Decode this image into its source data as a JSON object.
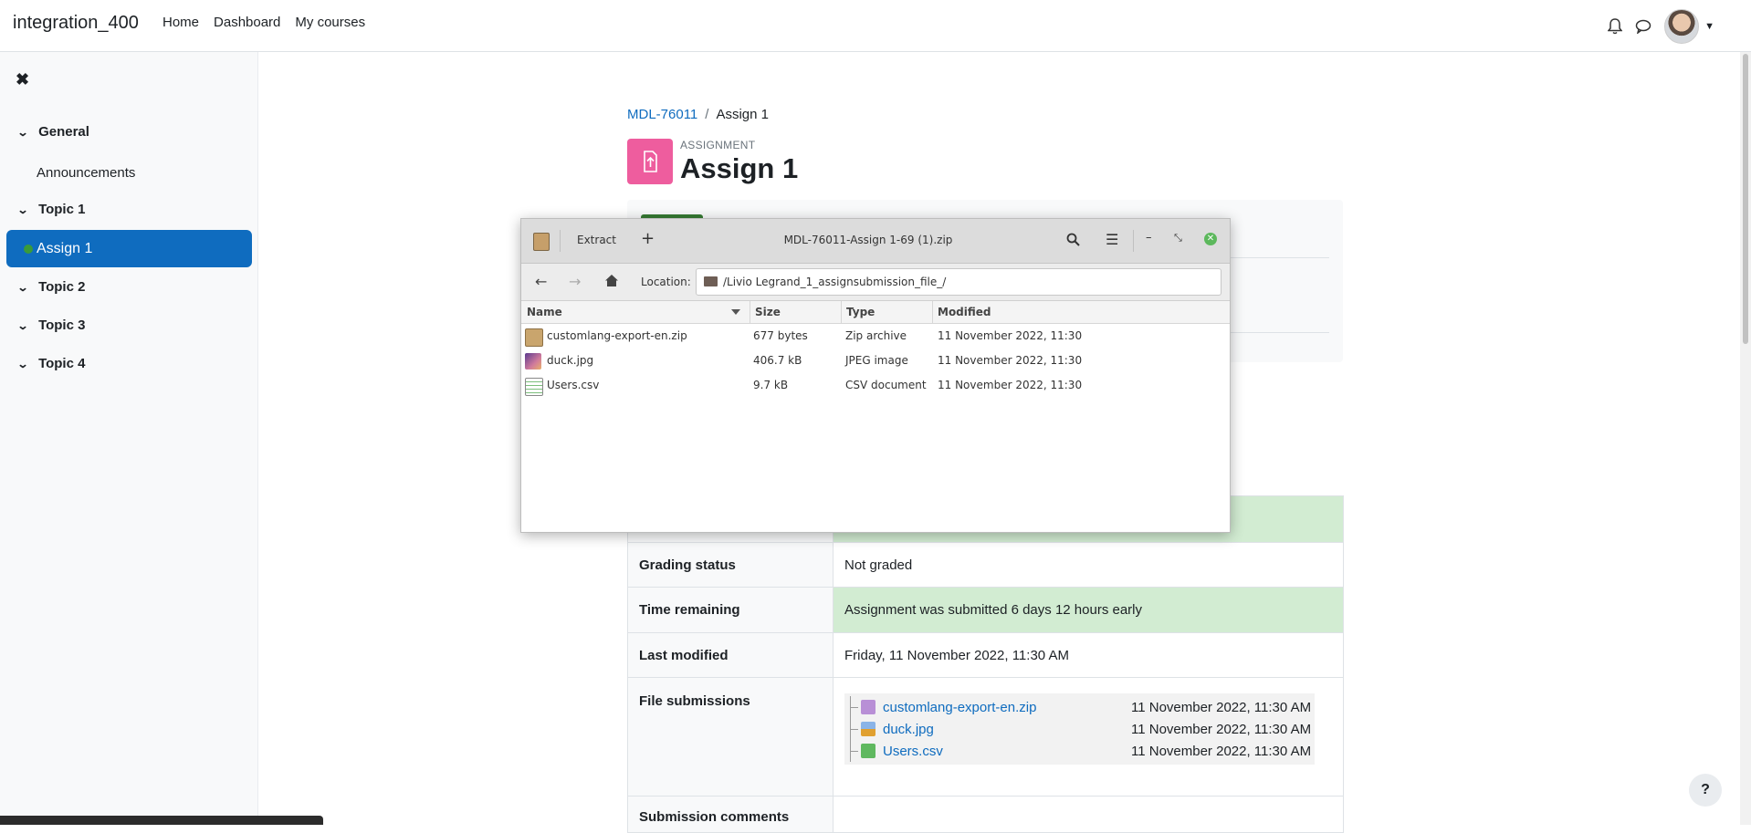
{
  "navbar": {
    "site_name": "integration_400",
    "links": [
      "Home",
      "Dashboard",
      "My courses"
    ]
  },
  "course_index": {
    "close_glyph": "✖",
    "sections": [
      {
        "label": "General",
        "items": [
          "Announcements"
        ]
      },
      {
        "label": "Topic 1",
        "items": [
          "Assign 1"
        ]
      },
      {
        "label": "Topic 2",
        "items": []
      },
      {
        "label": "Topic 3",
        "items": []
      },
      {
        "label": "Topic 4",
        "items": []
      }
    ],
    "active_item": "Assign 1"
  },
  "breadcrumb": {
    "course": "MDL-76011",
    "current": "Assign 1"
  },
  "activity": {
    "type": "ASSIGNMENT",
    "title": "Assign 1",
    "icon_color": "#ee5d9e"
  },
  "submission_status": {
    "rows": [
      {
        "label": "Grading status",
        "value": "Not graded"
      },
      {
        "label": "Time remaining",
        "value": "Assignment was submitted 6 days 12 hours early"
      },
      {
        "label": "Last modified",
        "value": "Friday, 11 November 2022, 11:30 AM"
      },
      {
        "label": "File submissions",
        "value": ""
      },
      {
        "label": "Submission comments",
        "value": ""
      }
    ],
    "files": [
      {
        "name": "customlang-export-en.zip",
        "date": "11 November 2022, 11:30 AM",
        "icon": "zip-icon"
      },
      {
        "name": "duck.jpg",
        "date": "11 November 2022, 11:30 AM",
        "icon": "image-icon"
      },
      {
        "name": "Users.csv",
        "date": "11 November 2022, 11:30 AM",
        "icon": "spreadsheet-icon"
      }
    ]
  },
  "help_button": "?",
  "archive_window": {
    "title": "MDL-76011-Assign 1-69 (1).zip",
    "extract_label": "Extract",
    "add_label": "+",
    "location_label": "Location:",
    "location_path": "/Livio Legrand_1_assignsubmission_file_/",
    "columns": [
      "Name",
      "Size",
      "Type",
      "Modified"
    ],
    "rows": [
      {
        "name": "customlang-export-en.zip",
        "size": "677 bytes",
        "type": "Zip archive",
        "modified": "11 November 2022, 11:30"
      },
      {
        "name": "duck.jpg",
        "size": "406.7 kB",
        "type": "JPEG image",
        "modified": "11 November 2022, 11:30"
      },
      {
        "name": "Users.csv",
        "size": "9.7 kB",
        "type": "CSV document",
        "modified": "11 November 2022, 11:30"
      }
    ]
  },
  "colors": {
    "brand_blue": "#0f6cbf",
    "success_green": "#d2ecd2"
  }
}
